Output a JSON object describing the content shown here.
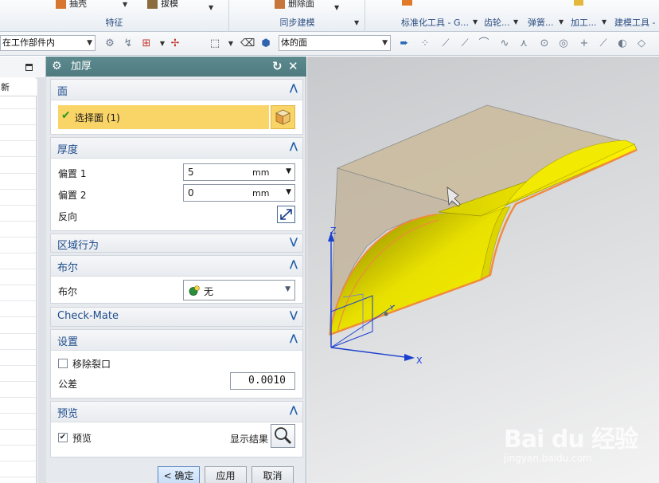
{
  "ribbon": {
    "groups": [
      {
        "label": "特征",
        "buttons": [
          "抽壳",
          "拔模"
        ]
      },
      {
        "label": "同步建模",
        "buttons": [
          "删除面"
        ]
      },
      {
        "label": "标准化工具 - G...",
        "buttons": []
      },
      {
        "label": "齿轮...",
        "buttons": []
      },
      {
        "label": "弹簧...",
        "buttons": []
      },
      {
        "label": "加工...",
        "buttons": []
      },
      {
        "label": "建模工具 -",
        "buttons": []
      }
    ]
  },
  "toolbar2": {
    "scope_filter": "在工作部件内",
    "face_rule": "体的面"
  },
  "navigator": {
    "column_header": "新"
  },
  "dialog": {
    "title": "加厚",
    "sections": {
      "face": {
        "title": "面",
        "select_label": "选择面 (1)"
      },
      "thickness": {
        "title": "厚度",
        "offset1_label": "偏置 1",
        "offset1_value": "5",
        "offset1_unit": "mm",
        "offset2_label": "偏置 2",
        "offset2_value": "0",
        "offset2_unit": "mm",
        "reverse_label": "反向"
      },
      "region": {
        "title": "区域行为"
      },
      "boolean": {
        "title": "布尔",
        "label": "布尔",
        "value": "无"
      },
      "checkmate": {
        "title": "Check-Mate"
      },
      "settings": {
        "title": "设置",
        "remove_crack_label": "移除裂口",
        "remove_crack_checked": false,
        "tolerance_label": "公差",
        "tolerance_value": "0.0010"
      },
      "preview": {
        "title": "预览",
        "preview_label": "预览",
        "preview_checked": true,
        "show_result_label": "显示结果"
      }
    },
    "buttons": {
      "ok": "< 确定 >",
      "apply": "应用",
      "cancel": "取消"
    }
  },
  "viewport": {
    "axes": {
      "z": "Z",
      "x": "X",
      "y": "Y"
    },
    "colors": {
      "body_fill": "#e8e000",
      "edge_highlight": "#f08a3c",
      "sheet_fill": "#c9b999",
      "axis": "#1a3fd0"
    }
  },
  "watermark": {
    "logo": "Bai du 经验",
    "url": "jingyan.baidu.com"
  }
}
